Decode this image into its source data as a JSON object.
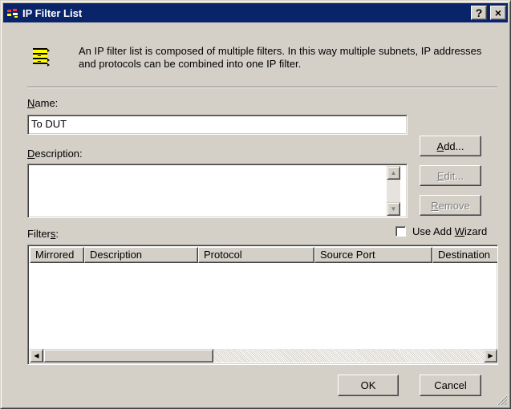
{
  "window": {
    "title": "IP Filter List"
  },
  "title_buttons": {
    "help": "?",
    "close": "×"
  },
  "info": {
    "text": "An IP filter list is composed of multiple filters. In this way multiple subnets, IP addresses and protocols can be combined into one IP filter."
  },
  "name": {
    "label_u": "N",
    "label_rest": "ame:",
    "value": "To DUT"
  },
  "description": {
    "label_u": "D",
    "label_rest": "escription:",
    "value": ""
  },
  "buttons": {
    "add_u": "A",
    "add_rest": "dd...",
    "edit_u": "E",
    "edit_rest": "dit...",
    "remove_u": "R",
    "remove_rest": "emove",
    "ok": "OK",
    "cancel": "Cancel"
  },
  "filters": {
    "label_pre": "Filter",
    "label_u": "s",
    "label_post": ":"
  },
  "wizard": {
    "label_pre": "Use Add ",
    "label_u": "W",
    "label_post": "izard",
    "checked": false
  },
  "list": {
    "columns": [
      "Mirrored",
      "Description",
      "Protocol",
      "Source Port",
      "Destination"
    ],
    "rows": []
  },
  "colors": {
    "titlebar": "#0a246a",
    "face": "#d4d0c8"
  }
}
